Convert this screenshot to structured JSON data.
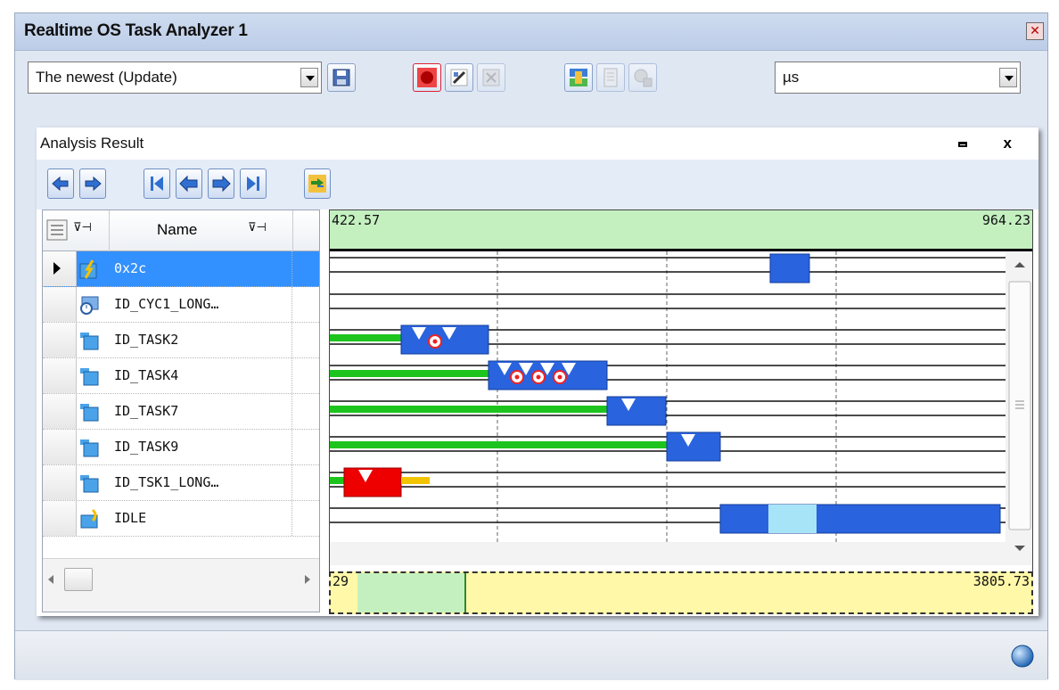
{
  "window": {
    "title": "Realtime OS Task Analyzer 1"
  },
  "toolbar": {
    "mode_combo": "The newest (Update)",
    "unit_combo": "µs"
  },
  "panel": {
    "title": "Analysis Result"
  },
  "grid": {
    "name_header": "Name",
    "rows": [
      {
        "name": "0x2c",
        "icon": "handler-icon",
        "selected": true
      },
      {
        "name": "ID_CYC1_LONG…",
        "icon": "cyclic-handler-icon"
      },
      {
        "name": "ID_TASK2",
        "icon": "task-icon"
      },
      {
        "name": "ID_TASK4",
        "icon": "task-icon"
      },
      {
        "name": "ID_TASK7",
        "icon": "task-icon"
      },
      {
        "name": "ID_TASK9",
        "icon": "task-icon"
      },
      {
        "name": "ID_TSK1_LONG…",
        "icon": "task-icon"
      },
      {
        "name": "IDLE",
        "icon": "idle-icon"
      }
    ]
  },
  "timeline": {
    "start": "422.57",
    "end": "964.23"
  },
  "overview": {
    "start": "29",
    "end": "3805.73"
  },
  "colors": {
    "running": "#2a63de",
    "ready": "#1ec41e",
    "error": "#ee0000",
    "wait": "#f2c400",
    "idle_highlight": "#a8e4f8",
    "header_green": "#c4f0c0",
    "overview_yellow": "#fff8a8",
    "selection": "#3390ff"
  }
}
